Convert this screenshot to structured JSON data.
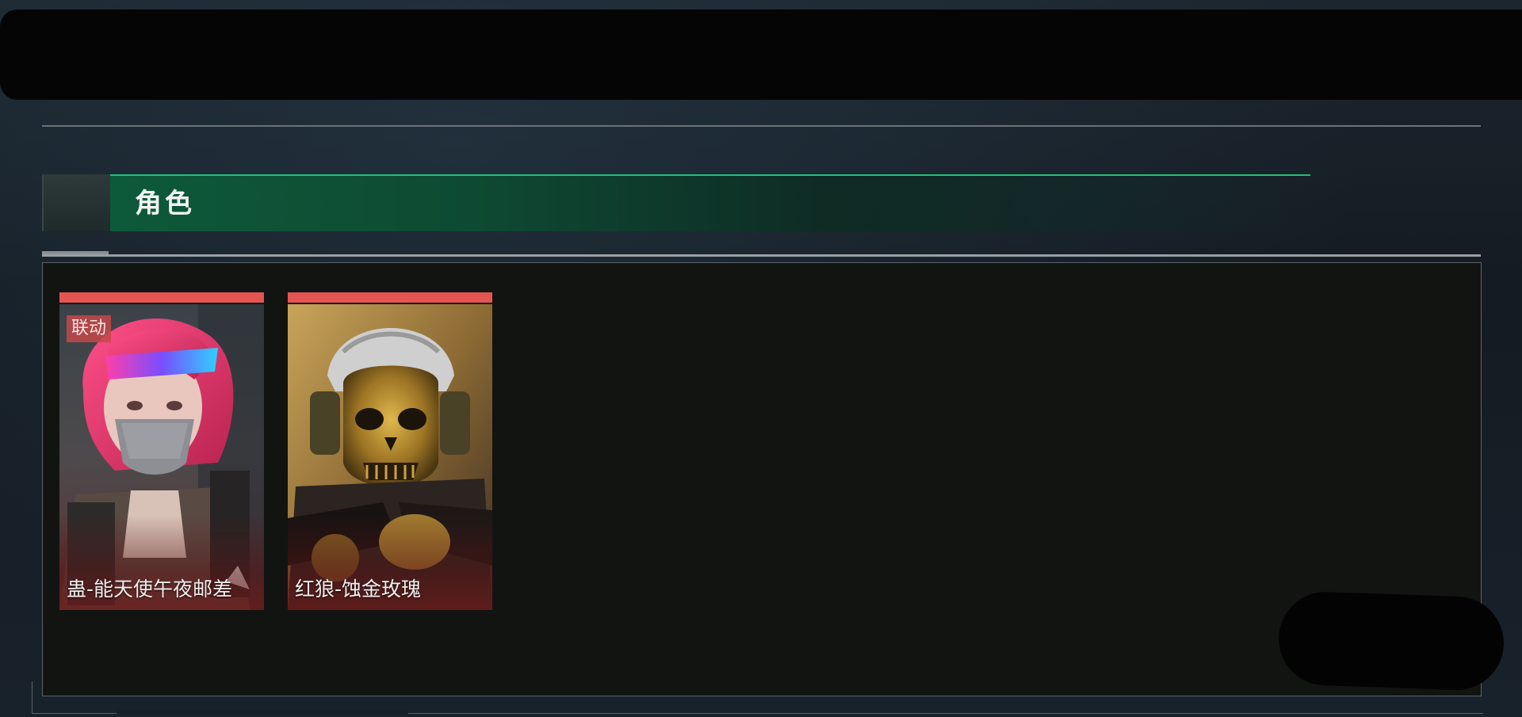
{
  "section": {
    "title": "角色"
  },
  "cards": [
    {
      "name": "蛊-能天使午夜邮差",
      "badge": "联动",
      "accent_color": "#e45552",
      "icon": "character-portrait-icon"
    },
    {
      "name": "红狼-蚀金玫瑰",
      "accent_color": "#e45552",
      "icon": "character-portrait-icon"
    }
  ],
  "colors": {
    "header_accent": "#22c07a",
    "panel_background": "#121412",
    "card_accent": "#e45552"
  }
}
